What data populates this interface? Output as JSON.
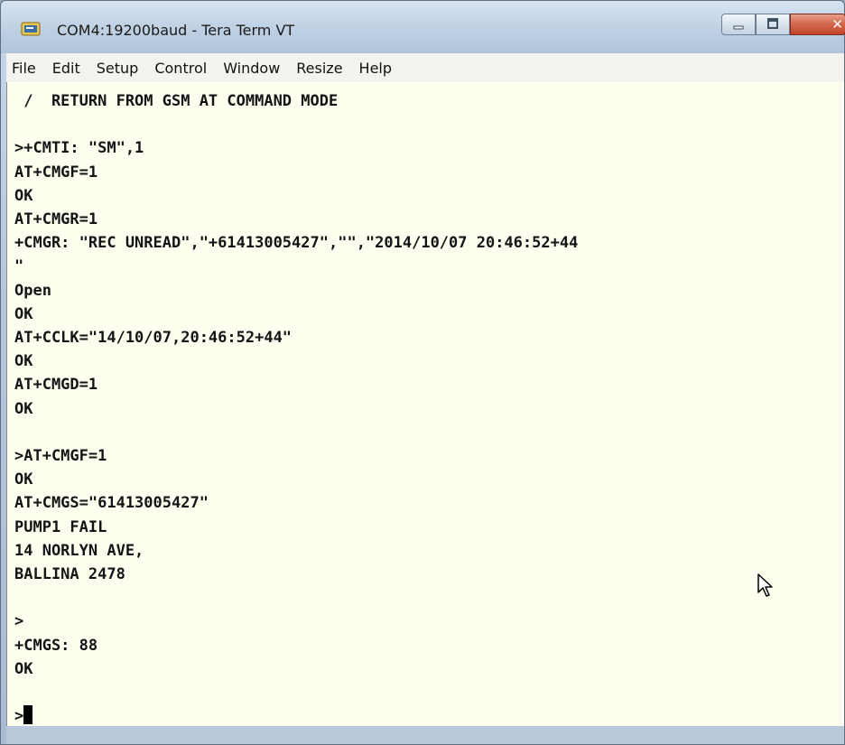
{
  "window": {
    "title": "COM4:19200baud - Tera Term VT",
    "icon": "tera-term-icon",
    "controls": [
      "minimize-icon",
      "maximize-icon",
      "close-icon"
    ]
  },
  "menu": {
    "items": [
      "File",
      "Edit",
      "Setup",
      "Control",
      "Window",
      "Resize",
      "Help"
    ]
  },
  "terminal": {
    "lines": [
      " /  RETURN FROM GSM AT COMMAND MODE",
      "",
      ">+CMTI: \"SM\",1",
      "AT+CMGF=1",
      "OK",
      "AT+CMGR=1",
      "+CMGR: \"REC UNREAD\",\"+61413005427\",\"\",\"2014/10/07 20:46:52+44",
      "\"",
      "Open",
      "OK",
      "AT+CCLK=\"14/10/07,20:46:52+44\"",
      "OK",
      "AT+CMGD=1",
      "OK",
      "",
      ">AT+CMGF=1",
      "OK",
      "AT+CMGS=\"61413005427\"",
      "PUMP1 FAIL",
      "14 NORLYN AVE,",
      "BALLINA 2478",
      "",
      ">",
      "+CMGS: 88",
      "OK",
      "",
      ">"
    ]
  },
  "colors": {
    "terminal_bg": "#fffff0",
    "terminal_fg": "#141414",
    "close_button": "#c2452a"
  }
}
